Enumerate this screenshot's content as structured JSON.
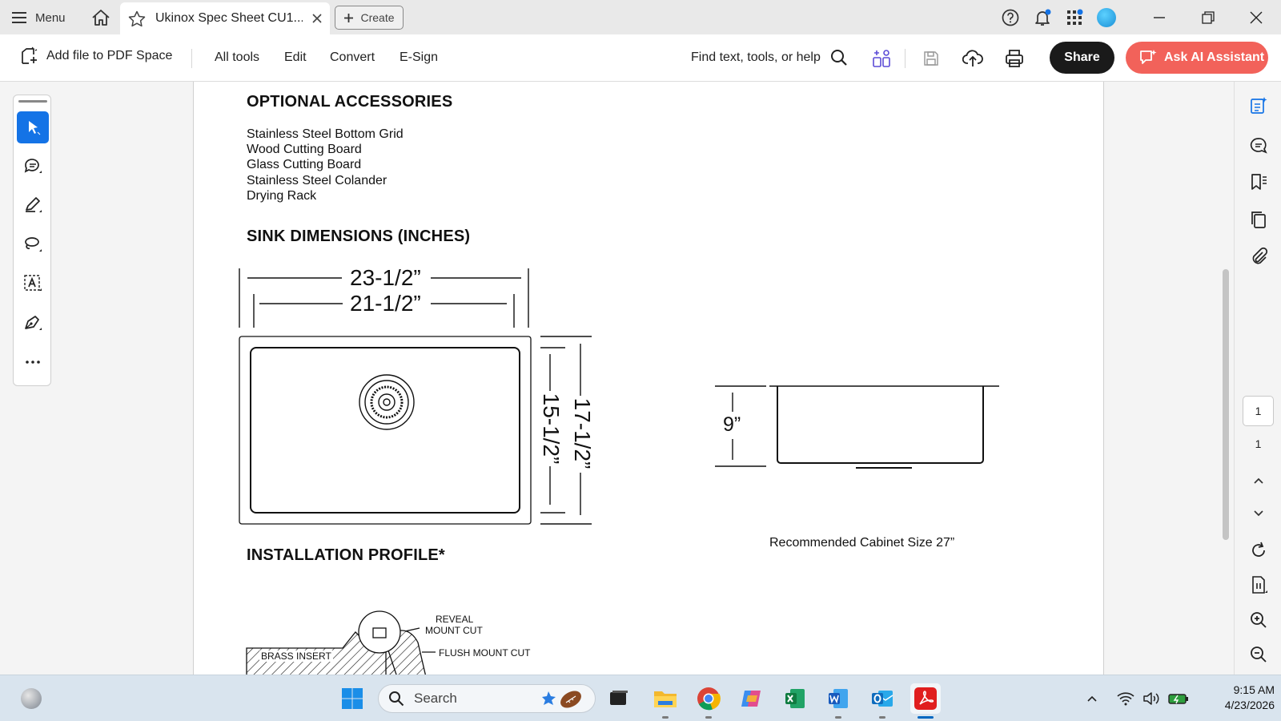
{
  "titlebar": {
    "menu_label": "Menu",
    "tab_title": "Ukinox Spec Sheet CU1...",
    "create_label": "Create"
  },
  "toolbar": {
    "add_file_label": "Add file to PDF Space",
    "menu_items": [
      "All tools",
      "Edit",
      "Convert",
      "E-Sign"
    ],
    "find_label": "Find text, tools, or help",
    "share_label": "Share",
    "ai_label": "Ask AI Assistant"
  },
  "document": {
    "accessories_heading": "OPTIONAL ACCESSORIES",
    "accessories": [
      "Stainless Steel Bottom Grid",
      "Wood Cutting Board",
      "Glass Cutting Board",
      "Stainless Steel Colander",
      "Drying Rack"
    ],
    "dimensions_heading": "SINK DIMENSIONS (INCHES)",
    "dim_outer_width": "23-1/2”",
    "dim_inner_width": "21-1/2”",
    "dim_outer_depth": "17-1/2”",
    "dim_inner_depth": "15-1/2”",
    "dim_height": "9”",
    "cabinet_note": "Recommended Cabinet Size 27”",
    "installation_heading": "INSTALLATION PROFILE*",
    "profile_labels": {
      "reveal": "REVEAL",
      "mount_cut": "MOUNT CUT",
      "flush": "FLUSH MOUNT CUT",
      "brass": "BRASS INSERT"
    }
  },
  "page_nav": {
    "current": "1",
    "total": "1"
  },
  "taskbar": {
    "search_label": "Search",
    "time": "9:15 AM",
    "date": "4/23/2026"
  },
  "colors": {
    "accent_blue": "#1473e6",
    "ai_button": "#f2625a",
    "share_button": "#1a1a1a",
    "taskbar": "#d9e4ee"
  }
}
